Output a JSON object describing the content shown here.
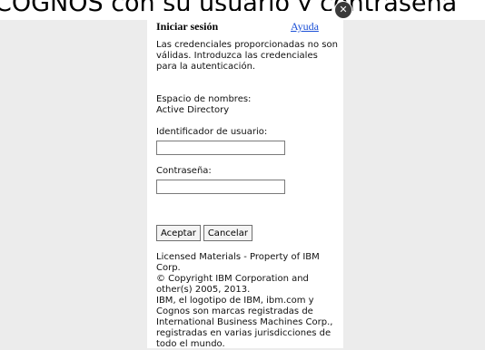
{
  "banner": {
    "text": "COGNOS con su usuario y contraseña"
  },
  "dialog": {
    "title": "Iniciar sesión",
    "help_link": "Ayuda",
    "error_message": "Las credenciales proporcionadas no son válidas. Introduzca las credenciales para la autenticación.",
    "namespace_label": "Espacio de nombres:",
    "namespace_value": "Active Directory",
    "user_label": "Identificador de usuario:",
    "user_value": "",
    "password_label": "Contraseña:",
    "password_value": "",
    "accept_label": "Aceptar",
    "cancel_label": "Cancelar",
    "legal": [
      "Licensed Materials - Property of IBM Corp.",
      "© Copyright IBM Corporation and other(s) 2005, 2013.",
      "IBM, el logotipo de IBM, ibm.com y Cognos son marcas registradas de International Business Machines Corp., registradas en varias jurisdicciones de todo el mundo."
    ]
  },
  "icons": {
    "close": "close-icon"
  }
}
